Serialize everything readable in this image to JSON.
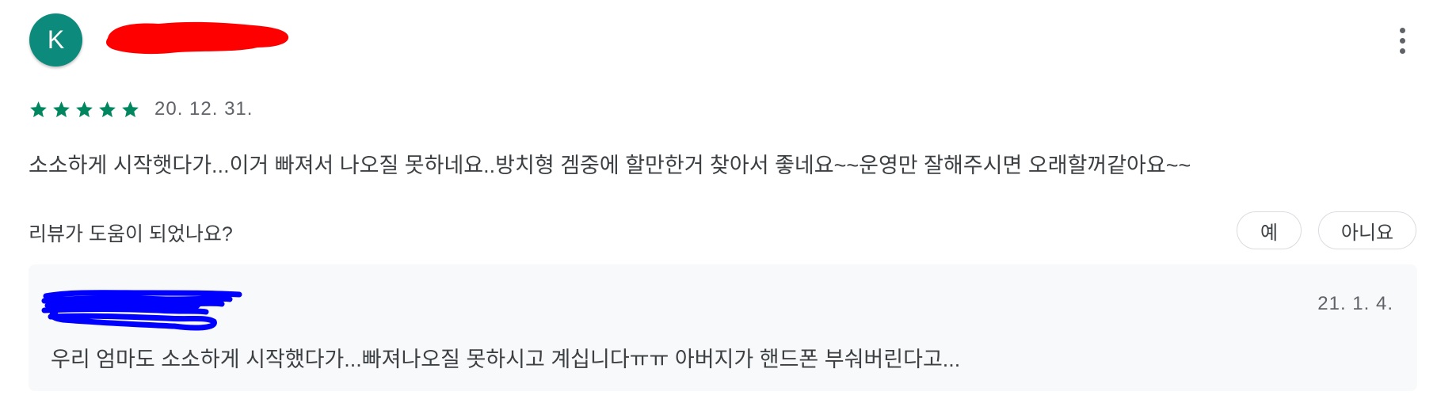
{
  "author": {
    "initial": "K"
  },
  "rating": {
    "stars": 5,
    "max": 5,
    "date": "20. 12. 31."
  },
  "review_text": "소소하게 시작햇다가...이거 빠져서 나오질 못하네요..방치형 겜중에 할만한거 찾아서 좋네요~~운영만 잘해주시면 오래할꺼같아요~~",
  "helpful": {
    "question": "리뷰가 도움이 되었나요?",
    "yes_label": "예",
    "no_label": "아니요"
  },
  "reply": {
    "date": "21. 1. 4.",
    "text": "우리 엄마도 소소하게 시작했다가...빠져나오질 못하시고 계십니다ㅠㅠ 아버지가 핸드폰 부숴버린다고..."
  },
  "colors": {
    "avatar": "#0c8a7b",
    "star": "#01875f",
    "redaction_top": "#ff0000",
    "redaction_reply": "#0000ff"
  },
  "icons": {
    "more": "more-vertical-icon",
    "star": "star-icon"
  }
}
